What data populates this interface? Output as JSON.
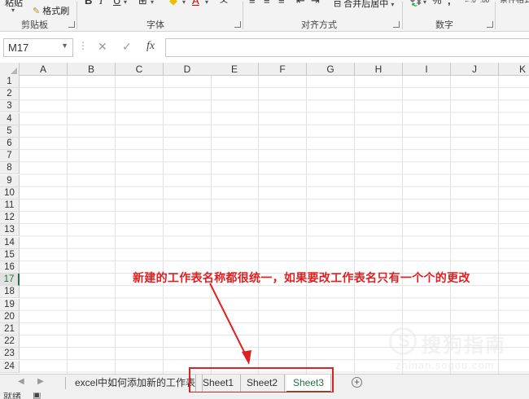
{
  "ribbon": {
    "paste_label": "粘贴",
    "format_painter": "格式刷",
    "groups": {
      "clipboard": "剪贴板",
      "font": "字体",
      "alignment": "对齐方式",
      "number": "数字"
    },
    "bold": "B",
    "italic": "I",
    "underline": "U",
    "merge_center": "合并后居中",
    "percent": "%",
    "comma": ","
  },
  "formula_bar": {
    "name_box": "M17",
    "fx": "fx",
    "formula": ""
  },
  "grid": {
    "columns": [
      "A",
      "B",
      "C",
      "D",
      "E",
      "F",
      "G",
      "H",
      "I",
      "J",
      "K"
    ],
    "rows": [
      "1",
      "2",
      "3",
      "4",
      "5",
      "6",
      "7",
      "8",
      "9",
      "10",
      "11",
      "12",
      "13",
      "14",
      "15",
      "16",
      "17",
      "18",
      "19",
      "20",
      "21",
      "22",
      "23",
      "24"
    ],
    "active_row": "17"
  },
  "annotation": {
    "text": "新建的工作表名称都很统一，如果要改工作表名只有一个个的更改",
    "color": "#e02020"
  },
  "sheet_tabs": {
    "tabs": [
      {
        "label": "excel中如何添加新的工作表"
      },
      {
        "label": "Sheet1"
      },
      {
        "label": "Sheet2"
      },
      {
        "label": "Sheet3"
      }
    ],
    "active": "Sheet3",
    "add_icon": "plus-circle-icon"
  },
  "status": {
    "ready": "就绪"
  },
  "watermark": {
    "text": "搜狗指南",
    "url": "zhinan.sogou.com"
  },
  "colors": {
    "excel_green": "#217346",
    "annotation_red": "#e02020"
  }
}
